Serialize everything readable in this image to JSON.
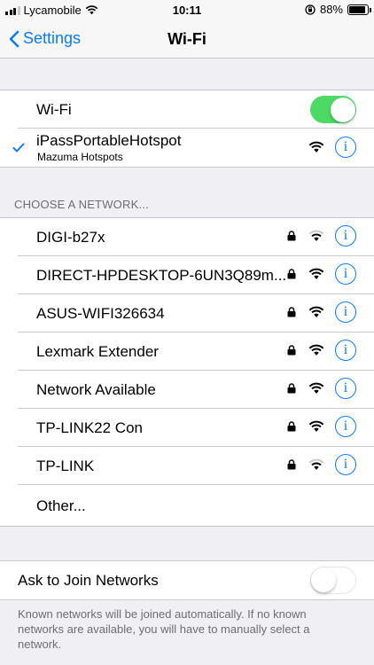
{
  "status_bar": {
    "carrier": "Lycamobile",
    "time": "10:11",
    "battery": "88%",
    "battery_level": 0.88
  },
  "nav": {
    "back_label": "Settings",
    "title": "Wi-Fi"
  },
  "wifi_toggle": {
    "label": "Wi-Fi",
    "on": true
  },
  "connected": {
    "name": "iPassPortableHotspot",
    "subtitle": "Mazuma Hotspots"
  },
  "section_header": "CHOOSE A NETWORK...",
  "networks": [
    {
      "name": "DIGI-b27x",
      "locked": true,
      "strength": 2
    },
    {
      "name": "DIRECT-HPDESKTOP-6UN3Q89m...",
      "locked": true,
      "strength": 3
    },
    {
      "name": "ASUS-WIFI326634",
      "locked": true,
      "strength": 3
    },
    {
      "name": "Lexmark Extender",
      "locked": true,
      "strength": 3
    },
    {
      "name": "Network Available",
      "locked": true,
      "strength": 3
    },
    {
      "name": "TP-LINK22 Con",
      "locked": true,
      "strength": 3
    },
    {
      "name": "TP-LINK",
      "locked": true,
      "strength": 2
    }
  ],
  "other_label": "Other...",
  "ask_to_join": {
    "label": "Ask to Join Networks",
    "on": false
  },
  "footer_note": "Known networks will be joined automatically. If no known networks are available, you will have to manually select a network.",
  "colors": {
    "accent": "#0a7aff",
    "toggle_on": "#4cd964",
    "background": "#efeff4"
  },
  "icons": [
    "cellular-signal-icon",
    "wifi-icon",
    "orientation-lock-icon",
    "battery-icon",
    "back-chevron-icon",
    "checkmark-icon",
    "lock-icon",
    "info-icon"
  ]
}
